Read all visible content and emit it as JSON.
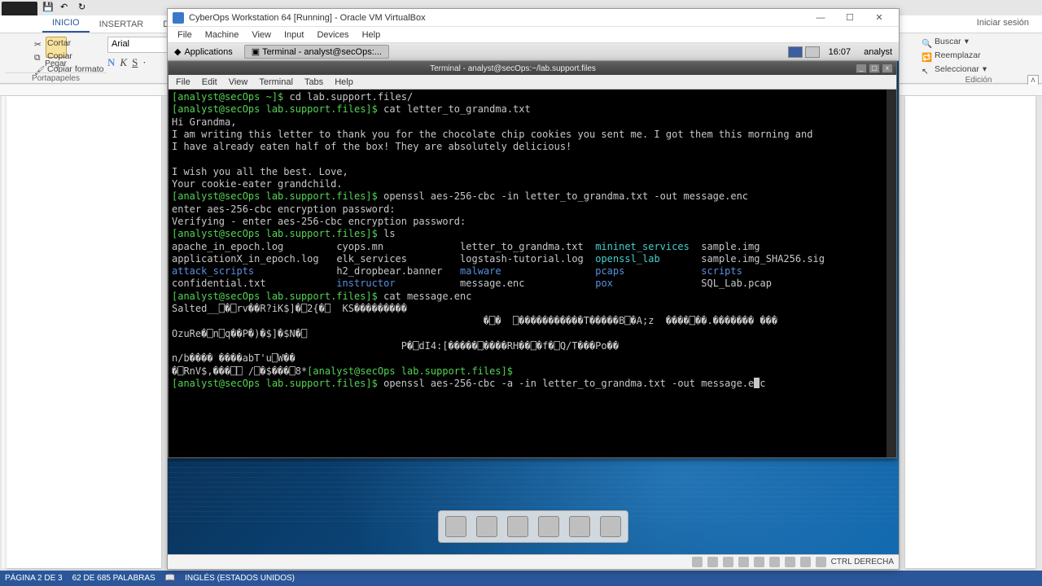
{
  "word": {
    "tabs": {
      "inicio": "INICIO",
      "insertar": "INSERTAR",
      "diseno": "DISEÑ"
    },
    "signin": "Iniciar sesión",
    "clipboard": {
      "cortar": "Cortar",
      "copiar": "Copiar",
      "formato": "Copiar formato",
      "pegar": "Pegar",
      "group": "Portapapeles"
    },
    "font": {
      "name": "Arial",
      "bold": "N",
      "italic": "K",
      "underline": "S"
    },
    "editing": {
      "buscar": "Buscar",
      "reemplazar": "Reemplazar",
      "seleccionar": "Seleccionar",
      "group": "Edición"
    },
    "status": {
      "page": "PÁGINA 2 DE 3",
      "words": "62 DE 685 PALABRAS",
      "lang": "INGLÉS (ESTADOS UNIDOS)"
    }
  },
  "vbox": {
    "title": "CyberOps Workstation 64 [Running] - Oracle VM VirtualBox",
    "menu": {
      "file": "File",
      "machine": "Machine",
      "view": "View",
      "input": "Input",
      "devices": "Devices",
      "help": "Help"
    },
    "hostkey": "CTRL DERECHA"
  },
  "xfce": {
    "apps": "Applications",
    "task": "Terminal - analyst@secOps:...",
    "clock": "16:07",
    "user": "analyst"
  },
  "terminal": {
    "title": "Terminal - analyst@secOps:~/lab.support.files",
    "menu": {
      "file": "File",
      "edit": "Edit",
      "view": "View",
      "terminal": "Terminal",
      "tabs": "Tabs",
      "help": "Help"
    },
    "prompt_home": "[analyst@secOps ~]$",
    "prompt_lab": "[analyst@secOps lab.support.files]$",
    "cmd_cd": " cd lab.support.files/",
    "cmd_cat_letter": " cat letter_to_grandma.txt",
    "letter_l1": "Hi Grandma,",
    "letter_l2": "I am writing this letter to thank you for the chocolate chip cookies you sent me. I got them this morning and",
    "letter_l3": "I have already eaten half of the box! They are absolutely delicious!",
    "letter_l4": "",
    "letter_l5": "I wish you all the best. Love,",
    "letter_l6": "Your cookie-eater grandchild.",
    "cmd_openssl1": " openssl aes-256-cbc -in letter_to_grandma.txt -out message.enc",
    "enc_pw": "enter aes-256-cbc encryption password:",
    "enc_verify": "Verifying - enter aes-256-cbc encryption password:",
    "cmd_ls": " ls",
    "ls": {
      "r1c1": "apache_in_epoch.log",
      "r1c2": "cyops.mn",
      "r1c3": "letter_to_grandma.txt",
      "r1c4": "mininet_services",
      "r1c5": "sample.img",
      "r2c1": "applicationX_in_epoch.log",
      "r2c2": "elk_services",
      "r2c3": "logstash-tutorial.log",
      "r2c4": "openssl_lab",
      "r2c5": "sample.img_SHA256.sig",
      "r3c1": "attack_scripts",
      "r3c2": "h2_dropbear.banner",
      "r3c3": "malware",
      "r3c4": "pcaps",
      "r3c5": "scripts",
      "r4c1": "confidential.txt",
      "r4c2": "instructor",
      "r4c3": "message.enc",
      "r4c4": "pox",
      "r4c5": "SQL_Lab.pcap"
    },
    "cmd_cat_enc": " cat message.enc",
    "enc_l1": "Salted__⎕�⎕rv��R?iK$]�⎕2{�⎕  KS���������",
    "enc_l2": "                                                     �⎕�  ⎕�����������T�����B⎕�A;z  ����⎕��.������� ���",
    "enc_l3": "OzuRe�⎕n⎕q��P�)�$]�$N�⎕",
    "enc_l4": "                                       P�⎕dI4:[�����⎕����RH��⎕�f�⎕Q/T���Po��",
    "enc_l5": "n/b���� ����abT'u⎕W��",
    "enc_l6": "�⎕RnV$,���⎕⎕ /⎕�$���⎕8*",
    "cmd_openssl2": " openssl aes-256-cbc -a -in letter_to_grandma.txt -out message.e",
    "cmd_openssl2b": "c"
  }
}
